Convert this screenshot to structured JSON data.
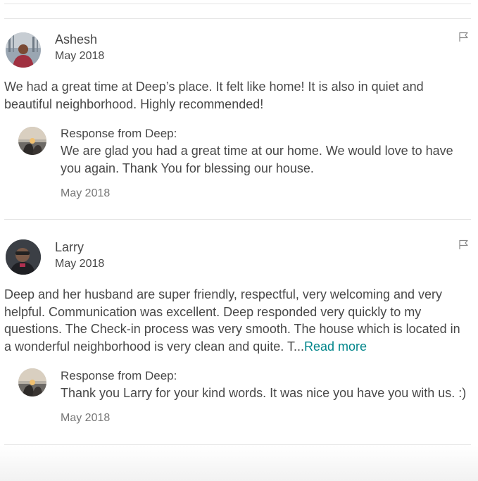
{
  "reviews": [
    {
      "name": "Ashesh",
      "date": "May 2018",
      "text": "We had a great time at Deep’s place. It felt like home! It is also in quiet and beautiful neighborhood. Highly recommended!",
      "response": {
        "title": "Response from Deep:",
        "text": "We are glad you had a great time at our home. We would love to have you again. Thank You for blessing our house.",
        "date": "May 2018"
      }
    },
    {
      "name": "Larry",
      "date": "May 2018",
      "text": "Deep and her husband are super friendly, respectful, very welcoming and very helpful. Communication was excellent. Deep responded very quickly to my questions. The Check-in process was very smooth. The house which is located in a wonderful neighborhood is very clean and quite. T...",
      "read_more": "Read more",
      "response": {
        "title": "Response from Deep:",
        "text": "Thank you Larry for your kind words. It was nice you have you with us. :)",
        "date": "May 2018"
      }
    }
  ],
  "icons": {
    "flag": "flag-icon",
    "accent_color": "#00858a"
  }
}
